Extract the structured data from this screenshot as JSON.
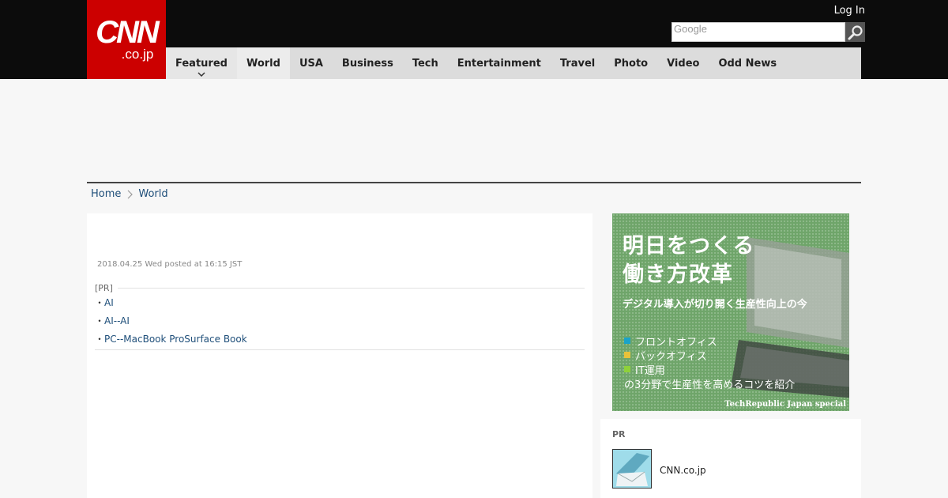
{
  "logo": {
    "main": "CNN",
    "sub": ".co.jp"
  },
  "header": {
    "login_label": "Log In",
    "search_placeholder": "Google"
  },
  "nav": {
    "items": [
      {
        "label": "Featured"
      },
      {
        "label": "World"
      },
      {
        "label": "USA"
      },
      {
        "label": "Business"
      },
      {
        "label": "Tech"
      },
      {
        "label": "Entertainment"
      },
      {
        "label": "Travel"
      },
      {
        "label": "Photo"
      },
      {
        "label": "Video"
      },
      {
        "label": "Odd News"
      }
    ],
    "active": "World"
  },
  "breadcrumb": {
    "home": "Home",
    "current": "World"
  },
  "article": {
    "dateline": "2018.04.25 Wed posted at 16:15 JST",
    "pr_heading": "[PR]",
    "pr_links": [
      "AI",
      "AI--AI",
      "PC--MacBook ProSurface Book"
    ]
  },
  "ad": {
    "headline_line1": "明日をつくる",
    "headline_line2": "働き方改革",
    "subhead": "デジタル導入が切り開く生産性向上の今",
    "items": [
      {
        "label": "フロントオフィス",
        "color": "#1aa3c9"
      },
      {
        "label": "バックオフィス",
        "color": "#e8c23a"
      },
      {
        "label": "IT運用",
        "color": "#8fd13a"
      }
    ],
    "footer": "の3分野で生産性を高めるコツを紹介",
    "brand": "TechRepublic Japan special"
  },
  "sidebar_pr": {
    "title": "PR",
    "item_label": "CNN.co.jp"
  },
  "colors": {
    "brand_red": "#cc0000",
    "link": "#1f4f7a",
    "header_bg": "#0c0c0c",
    "nav_bg": "#dcdcdc"
  }
}
